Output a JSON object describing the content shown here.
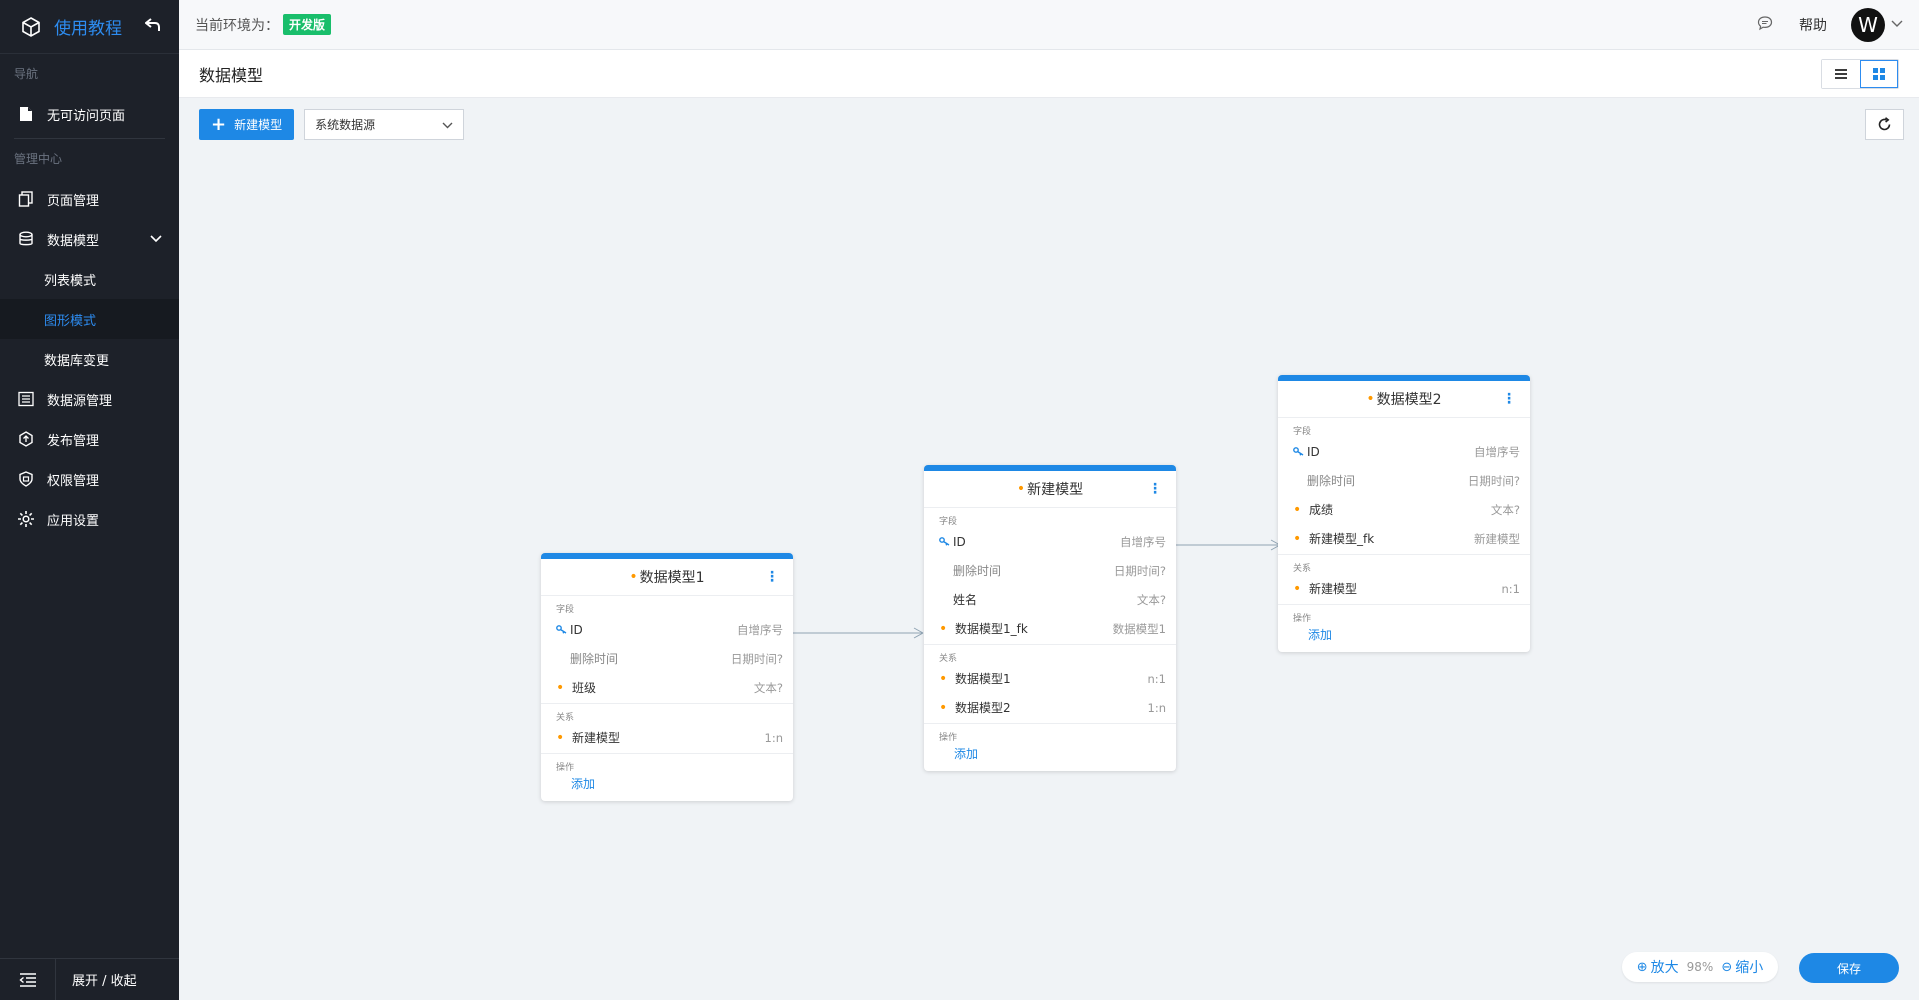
{
  "app": {
    "title": "使用教程",
    "back_icon": "undo-icon"
  },
  "sidebar": {
    "section_nav": "导航",
    "nav_items": [
      {
        "label": "无可访问页面",
        "icon": "file-icon"
      }
    ],
    "section_admin": "管理中心",
    "items": [
      {
        "label": "页面管理",
        "icon": "pages-icon"
      },
      {
        "label": "数据模型",
        "icon": "database-icon"
      },
      {
        "label": "列表模式"
      },
      {
        "label": "图形模式"
      },
      {
        "label": "数据库变更"
      },
      {
        "label": "数据源管理",
        "icon": "datasource-icon"
      },
      {
        "label": "发布管理",
        "icon": "publish-icon"
      },
      {
        "label": "权限管理",
        "icon": "shield-icon"
      },
      {
        "label": "应用设置",
        "icon": "gear-icon"
      }
    ],
    "footer_label": "展开 / 收起"
  },
  "header": {
    "env_label": "当前环境为：",
    "env_badge": "开发版",
    "help": "帮助",
    "avatar_letter": "W"
  },
  "page": {
    "title": "数据模型"
  },
  "toolbar": {
    "new_model": "新建模型",
    "datasource_value": "系统数据源"
  },
  "models": [
    {
      "title": "数据模型1",
      "fields_label": "字段",
      "fields": [
        {
          "name": "ID",
          "type": "自增序号"
        },
        {
          "name": "删除时间",
          "type": "日期时间?"
        },
        {
          "name": "班级",
          "type": "文本?"
        }
      ],
      "relations_label": "关系",
      "relations": [
        {
          "name": "新建模型",
          "type": "1:n"
        }
      ],
      "ops_label": "操作",
      "add": "添加"
    },
    {
      "title": "新建模型",
      "fields_label": "字段",
      "fields": [
        {
          "name": "ID",
          "type": "自增序号"
        },
        {
          "name": "删除时间",
          "type": "日期时间?"
        },
        {
          "name": "姓名",
          "type": "文本?"
        },
        {
          "name": "数据模型1_fk",
          "type": "数据模型1"
        }
      ],
      "relations_label": "关系",
      "relations": [
        {
          "name": "数据模型1",
          "type": "n:1"
        },
        {
          "name": "数据模型2",
          "type": "1:n"
        }
      ],
      "ops_label": "操作",
      "add": "添加"
    },
    {
      "title": "数据模型2",
      "fields_label": "字段",
      "fields": [
        {
          "name": "ID",
          "type": "自增序号"
        },
        {
          "name": "删除时间",
          "type": "日期时间?"
        },
        {
          "name": "成绩",
          "type": "文本?"
        },
        {
          "name": "新建模型_fk",
          "type": "新建模型"
        }
      ],
      "relations_label": "关系",
      "relations": [
        {
          "name": "新建模型",
          "type": "n:1"
        }
      ],
      "ops_label": "操作",
      "add": "添加"
    }
  ],
  "zoom": {
    "zoom_in": "放大",
    "level": "98%",
    "zoom_out": "缩小"
  },
  "save": "保存",
  "colors": {
    "accent": "#1e88e5",
    "sidebar_bg": "#1d2129",
    "env_badge": "#19be6b",
    "required_dot": "#ff9900"
  }
}
